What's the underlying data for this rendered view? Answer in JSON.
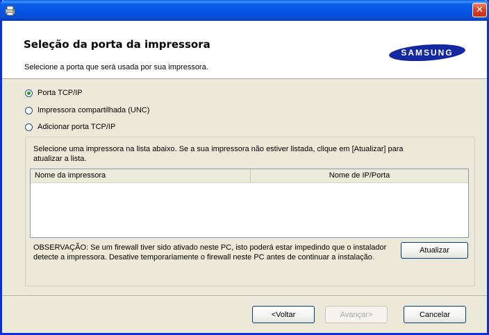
{
  "window": {
    "close_glyph": "✕"
  },
  "header": {
    "title": "Seleção da porta da impressora",
    "subtitle": "Selecione a porta que será usada por sua impressora.",
    "logo_text": "SAMSUNG"
  },
  "port_options": [
    {
      "label": "Porta TCP/IP",
      "checked": true
    },
    {
      "label": "Impressora compartilhada (UNC)",
      "checked": false
    },
    {
      "label": "Adicionar porta TCP/IP",
      "checked": false
    }
  ],
  "printer_list": {
    "description": "Selecione uma impressora na lista abaixo. Se a sua impressora não estiver listada, clique em [Atualizar] para atualizar a lista.",
    "columns": [
      "Nome da impressora",
      "Nome de IP/Porta"
    ],
    "rows": []
  },
  "note": "OBSERVAÇÃO: Se um firewall tiver sido ativado neste PC, isto poderá estar impedindo que o instalador detecte a impressora. Desative temporariamente o firewall neste PC antes de continuar a instalação.",
  "buttons": {
    "refresh": "Atualizar",
    "back": "<Voltar",
    "next": "Avançar>",
    "cancel": "Cancelar"
  }
}
